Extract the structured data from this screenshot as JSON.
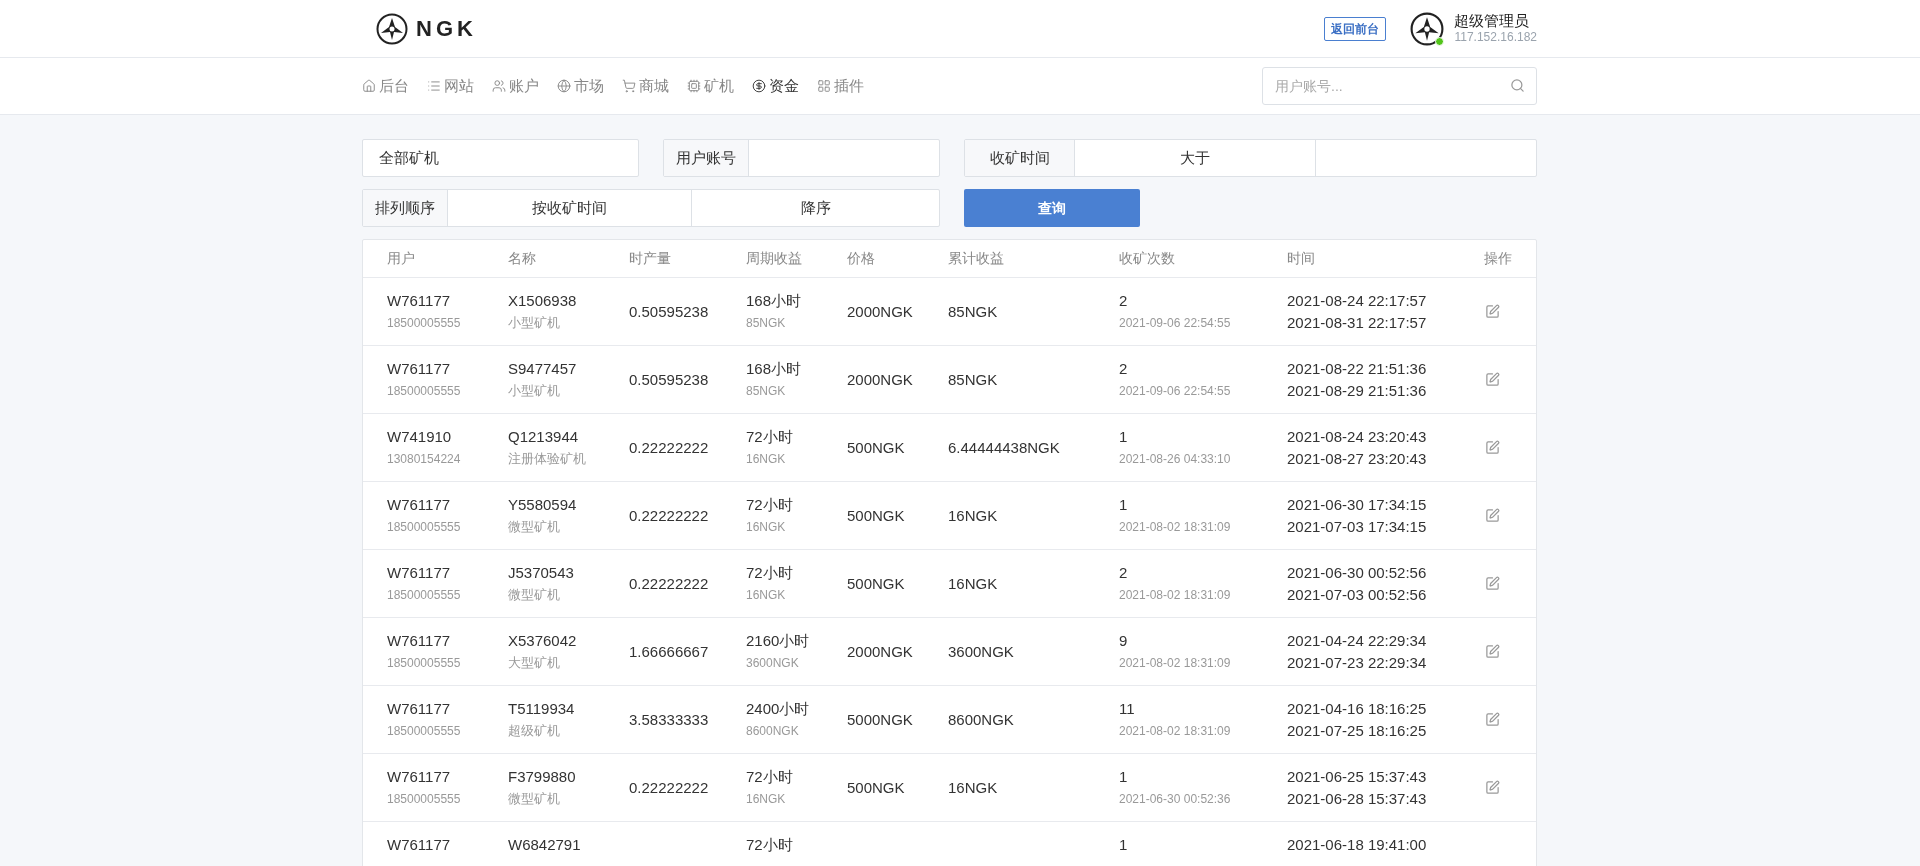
{
  "header": {
    "logo_text": "NGK",
    "back_button": "返回前台",
    "user": {
      "name": "超级管理员",
      "ip": "117.152.16.182",
      "online": true
    }
  },
  "nav": {
    "items": [
      {
        "label": "后台",
        "selected": false
      },
      {
        "label": "网站",
        "selected": false
      },
      {
        "label": "账户",
        "selected": false
      },
      {
        "label": "市场",
        "selected": false
      },
      {
        "label": "商城",
        "selected": false
      },
      {
        "label": "矿机",
        "selected": false
      },
      {
        "label": "资金",
        "selected": true
      },
      {
        "label": "插件",
        "selected": false
      }
    ],
    "search": {
      "placeholder": "用户账号..."
    }
  },
  "filters": {
    "miner_select": "全部矿机",
    "account": {
      "label": "用户账号"
    },
    "time": {
      "label": "收矿时间",
      "operator": "大于"
    },
    "sort": {
      "label": "排列顺序",
      "field": "按收矿时间",
      "order": "降序"
    },
    "query_button": "查询"
  },
  "table": {
    "columns": [
      "用户",
      "名称",
      "时产量",
      "周期收益",
      "价格",
      "累计收益",
      "收矿次数",
      "时间",
      "操作"
    ],
    "rows": [
      {
        "user": "W761177",
        "phone": "18500005555",
        "name": "X1506938",
        "type": "小型矿机",
        "hourly": "0.50595238",
        "cycle": "168小时",
        "cycle_income": "85NGK",
        "price": "2000NGK",
        "total": "85NGK",
        "count": "2",
        "last": "2021-09-06 22:54:55",
        "start": "2021-08-24 22:17:57",
        "end": "2021-08-31 22:17:57"
      },
      {
        "user": "W761177",
        "phone": "18500005555",
        "name": "S9477457",
        "type": "小型矿机",
        "hourly": "0.50595238",
        "cycle": "168小时",
        "cycle_income": "85NGK",
        "price": "2000NGK",
        "total": "85NGK",
        "count": "2",
        "last": "2021-09-06 22:54:55",
        "start": "2021-08-22 21:51:36",
        "end": "2021-08-29 21:51:36"
      },
      {
        "user": "W741910",
        "phone": "13080154224",
        "name": "Q1213944",
        "type": "注册体验矿机",
        "hourly": "0.22222222",
        "cycle": "72小时",
        "cycle_income": "16NGK",
        "price": "500NGK",
        "total": "6.44444438NGK",
        "count": "1",
        "last": "2021-08-26 04:33:10",
        "start": "2021-08-24 23:20:43",
        "end": "2021-08-27 23:20:43"
      },
      {
        "user": "W761177",
        "phone": "18500005555",
        "name": "Y5580594",
        "type": "微型矿机",
        "hourly": "0.22222222",
        "cycle": "72小时",
        "cycle_income": "16NGK",
        "price": "500NGK",
        "total": "16NGK",
        "count": "1",
        "last": "2021-08-02 18:31:09",
        "start": "2021-06-30 17:34:15",
        "end": "2021-07-03 17:34:15"
      },
      {
        "user": "W761177",
        "phone": "18500005555",
        "name": "J5370543",
        "type": "微型矿机",
        "hourly": "0.22222222",
        "cycle": "72小时",
        "cycle_income": "16NGK",
        "price": "500NGK",
        "total": "16NGK",
        "count": "2",
        "last": "2021-08-02 18:31:09",
        "start": "2021-06-30 00:52:56",
        "end": "2021-07-03 00:52:56"
      },
      {
        "user": "W761177",
        "phone": "18500005555",
        "name": "X5376042",
        "type": "大型矿机",
        "hourly": "1.66666667",
        "cycle": "2160小时",
        "cycle_income": "3600NGK",
        "price": "2000NGK",
        "total": "3600NGK",
        "count": "9",
        "last": "2021-08-02 18:31:09",
        "start": "2021-04-24 22:29:34",
        "end": "2021-07-23 22:29:34"
      },
      {
        "user": "W761177",
        "phone": "18500005555",
        "name": "T5119934",
        "type": "超级矿机",
        "hourly": "3.58333333",
        "cycle": "2400小时",
        "cycle_income": "8600NGK",
        "price": "5000NGK",
        "total": "8600NGK",
        "count": "11",
        "last": "2021-08-02 18:31:09",
        "start": "2021-04-16 18:16:25",
        "end": "2021-07-25 18:16:25"
      },
      {
        "user": "W761177",
        "phone": "18500005555",
        "name": "F3799880",
        "type": "微型矿机",
        "hourly": "0.22222222",
        "cycle": "72小时",
        "cycle_income": "16NGK",
        "price": "500NGK",
        "total": "16NGK",
        "count": "1",
        "last": "2021-06-30 00:52:36",
        "start": "2021-06-25 15:37:43",
        "end": "2021-06-28 15:37:43"
      },
      {
        "user": "W761177",
        "name": "W6842791",
        "cycle": "72小时",
        "count": "1",
        "start": "2021-06-18 19:41:00"
      }
    ]
  }
}
